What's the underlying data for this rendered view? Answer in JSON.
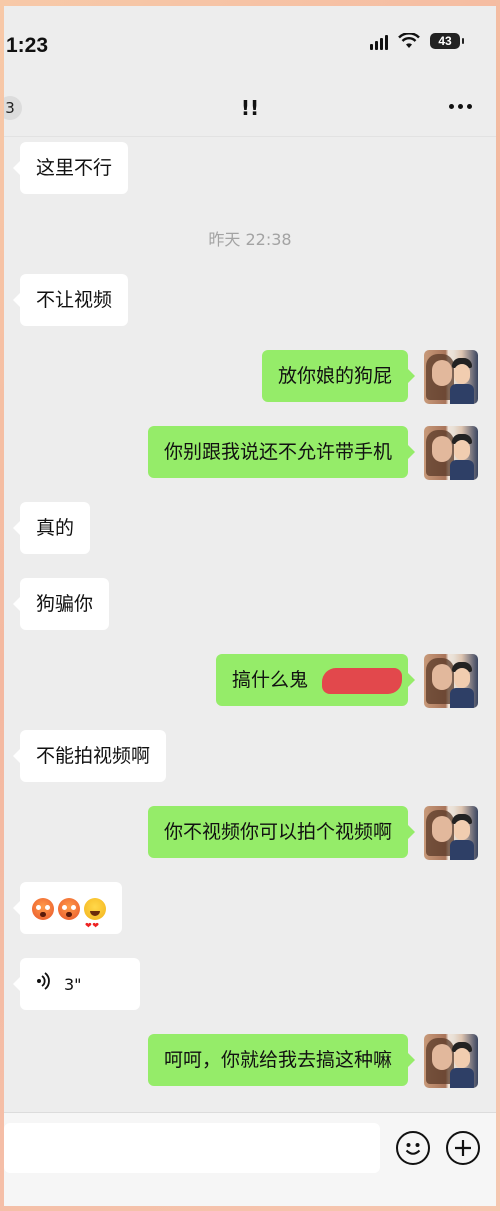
{
  "status_bar": {
    "time": "1:23",
    "battery": "43"
  },
  "header": {
    "back_badge": "3",
    "title": "!!"
  },
  "messages": [
    {
      "side": "left",
      "text": "这里不行"
    },
    {
      "side": "center",
      "text": "昨天 22:38"
    },
    {
      "side": "left",
      "text": "不让视频"
    },
    {
      "side": "right",
      "text": "放你娘的狗屁"
    },
    {
      "side": "right",
      "text": "你别跟我说还不允许带手机"
    },
    {
      "side": "left",
      "text": "真的"
    },
    {
      "side": "left",
      "text": "狗骗你"
    },
    {
      "side": "right",
      "text": "搞什么鬼"
    },
    {
      "side": "left",
      "text": "不能拍视频啊"
    },
    {
      "side": "right",
      "text": "你不视频你可以拍个视频啊"
    },
    {
      "side": "left",
      "emoji": [
        "shocked-face",
        "shocked-face",
        "heart-eyes-face"
      ]
    },
    {
      "side": "left",
      "voice_duration": "3\""
    },
    {
      "side": "right",
      "text": "呵呵，你就给我去搞这种嘛"
    }
  ],
  "colors": {
    "sent_bubble": "#95ec69",
    "received_bubble": "#ffffff",
    "chat_background": "#ededed",
    "censor_mark": "#e8394a"
  }
}
